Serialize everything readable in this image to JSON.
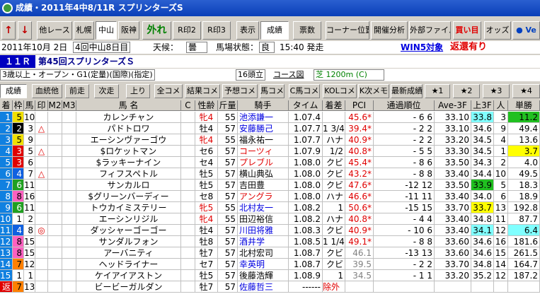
{
  "window": {
    "title": "成績・2011年4中8/11R スプリンターズS"
  },
  "toolbar": {
    "buttons": [
      "↑",
      "↓",
      "他レース",
      "札幌",
      "中山",
      "阪神",
      "外れ",
      "R印2",
      "R印3",
      "表示",
      "成績",
      "票数",
      "コーナー位置",
      "開催分析",
      "外部ファイル",
      "買い目",
      "オッズ",
      "● Ve"
    ],
    "active": [
      "中山",
      "成績"
    ]
  },
  "info": {
    "date": "2011年10月 2日",
    "meeting": "4回中山8日目",
    "weather_label": "天候：",
    "weather": "曇",
    "track_label": "馬場状態：",
    "track": "良",
    "start": "15:40 発走",
    "win5": "WIN5対象",
    "refund": "返還有り",
    "race_no": "１１Ｒ",
    "race_name": "第45回スプリンターズＳ",
    "conditions": "3歳以上・オープン・G1(定量)(国際)(指定)",
    "runners": "16頭立",
    "course_label": "コース図",
    "course": "芝 1200m (C)"
  },
  "tabs": [
    "成績",
    "血統他",
    "前走",
    "次走",
    "上り",
    "全コメ",
    "結果コメ",
    "予想コメ",
    "馬コメ",
    "C馬コメ",
    "KOLコメ",
    "K次メモ",
    "最新成績",
    "★1",
    "★2",
    "★3",
    "★4"
  ],
  "columns": [
    "着",
    "枠",
    "馬",
    "印",
    "M2",
    "M3",
    "馬 名",
    "C",
    "性齢",
    "斤量",
    "騎手",
    "タイム",
    "着差",
    "PCI",
    "通過順位",
    "Ave-3F",
    "上3F",
    "人",
    "単勝"
  ],
  "rows": [
    {
      "pos": "1",
      "waku": "5",
      "uma": "10",
      "mark": "",
      "name": "カレンチャン",
      "sex": "牝4",
      "kin": "55",
      "jockey": "池添謙一",
      "time": "1.07.4",
      "diff": "",
      "pci": "45.6*",
      "pass": "- 6 6",
      "ave": "33.10",
      "up3": "33.8",
      "ninki": "3",
      "odds": "11.2"
    },
    {
      "pos": "2",
      "waku": "2",
      "uma": "3",
      "mark": "△",
      "name": "パドトロワ",
      "sex": "牡4",
      "kin": "57",
      "jockey": "安藤勝己",
      "time": "1.07.7",
      "diff": "1 3/4",
      "pci": "39.4*",
      "pass": "- 2 2",
      "ave": "33.10",
      "up3": "34.6",
      "ninki": "9",
      "odds": "49.4"
    },
    {
      "pos": "3",
      "waku": "5",
      "uma": "9",
      "mark": "",
      "name": "エーシンヴァーゴウ",
      "sex": "牝4",
      "kin": "55",
      "jockey": "福永祐一",
      "time": "1.07.7",
      "diff": "ハナ",
      "pci": "40.9*",
      "pass": "- 2 2",
      "ave": "33.20",
      "up3": "34.5",
      "ninki": "4",
      "odds": "13.6"
    },
    {
      "pos": "4",
      "waku": "3",
      "uma": "5",
      "mark": "△",
      "name": "$ロケットマン",
      "sex": "セ6",
      "kin": "57",
      "jockey": "コーツィ",
      "time": "1.07.9",
      "diff": "1/2",
      "pci": "40.8*",
      "pass": "- 5 5",
      "ave": "33.30",
      "up3": "34.5",
      "ninki": "1",
      "odds": "3.7"
    },
    {
      "pos": "5",
      "waku": "3",
      "uma": "6",
      "mark": "",
      "name": "$ラッキーナイン",
      "sex": "セ4",
      "kin": "57",
      "jockey": "プレブル",
      "time": "1.08.0",
      "diff": "クビ",
      "pci": "45.4*",
      "pass": "- 8 6",
      "ave": "33.50",
      "up3": "34.3",
      "ninki": "2",
      "odds": "4.0"
    },
    {
      "pos": "6",
      "waku": "4",
      "uma": "7",
      "mark": "△",
      "name": "フィフスペトル",
      "sex": "牡5",
      "kin": "57",
      "jockey": "横山典弘",
      "time": "1.08.0",
      "diff": "クビ",
      "pci": "43.2*",
      "pass": "- 8 8",
      "ave": "33.40",
      "up3": "34.4",
      "ninki": "10",
      "odds": "49.5"
    },
    {
      "pos": "7",
      "waku": "6",
      "uma": "11",
      "mark": "",
      "name": "サンカルロ",
      "sex": "牡5",
      "kin": "57",
      "jockey": "吉田豊",
      "time": "1.08.0",
      "diff": "クビ",
      "pci": "47.6*",
      "pass": "-12 12",
      "ave": "33.50",
      "up3": "33.9",
      "ninki": "5",
      "odds": "18.3"
    },
    {
      "pos": "8",
      "waku": "8",
      "uma": "16",
      "mark": "",
      "name": "$グリーンバーディー",
      "sex": "セ8",
      "kin": "57",
      "jockey": "アングラ",
      "time": "1.08.0",
      "diff": "ハナ",
      "pci": "46.6*",
      "pass": "-11 11",
      "ave": "33.40",
      "up3": "34.0",
      "ninki": "6",
      "odds": "18.9"
    },
    {
      "pos": "9",
      "waku": "6",
      "uma": "11",
      "mark": "",
      "name": "トウカイミステリー",
      "sex": "牝5",
      "kin": "55",
      "jockey": "北村友一",
      "time": "1.08.2",
      "diff": "1",
      "pci": "50.6*",
      "pass": "-15 15",
      "ave": "33.70",
      "up3": "33.7",
      "ninki": "13",
      "odds": "192.8"
    },
    {
      "pos": "10",
      "waku": "1",
      "uma": "2",
      "mark": "",
      "name": "エーシンリジル",
      "sex": "牝4",
      "kin": "55",
      "jockey": "田辺裕信",
      "time": "1.08.2",
      "diff": "ハナ",
      "pci": "40.8*",
      "pass": "- 4 4",
      "ave": "33.40",
      "up3": "34.8",
      "ninki": "11",
      "odds": "87.7"
    },
    {
      "pos": "11",
      "waku": "4",
      "uma": "8",
      "mark": "◎",
      "name": "ダッシャーゴーゴー",
      "sex": "牡4",
      "kin": "57",
      "jockey": "川田将雅",
      "time": "1.08.3",
      "diff": "クビ",
      "pci": "40.9*",
      "pass": "- 10 6",
      "ave": "33.40",
      "up3": "34.1",
      "ninki": "12",
      "odds": "6.4"
    },
    {
      "pos": "12",
      "waku": "8",
      "uma": "15",
      "mark": "",
      "name": "サンダルフォン",
      "sex": "牡8",
      "kin": "57",
      "jockey": "酒井学",
      "time": "1.08.5",
      "diff": "1 1/4",
      "pci": "49.1*",
      "pass": "- 8 8",
      "ave": "33.60",
      "up3": "34.6",
      "ninki": "16",
      "odds": "181.6"
    },
    {
      "pos": "13",
      "waku": "8",
      "uma": "15",
      "mark": "",
      "name": "アーバニティ",
      "sex": "牡7",
      "kin": "57",
      "jockey": "北村宏司",
      "time": "1.08.7",
      "diff": "クビ",
      "pci": "46.1",
      "pass": "-13 13",
      "ave": "33.60",
      "up3": "34.6",
      "ninki": "15",
      "odds": "261.5"
    },
    {
      "pos": "14",
      "waku": "7",
      "uma": "12",
      "mark": "",
      "name": "ヘッドライナー",
      "sex": "セ7",
      "kin": "57",
      "jockey": "幸英明",
      "time": "1.08.7",
      "diff": "クビ",
      "pci": "39.5",
      "pass": "- 2 2",
      "ave": "33.70",
      "up3": "34.8",
      "ninki": "14",
      "odds": "164.7"
    },
    {
      "pos": "15",
      "waku": "1",
      "uma": "1",
      "mark": "",
      "name": "ケイアイアストン",
      "sex": "牡5",
      "kin": "57",
      "jockey": "後藤浩輝",
      "time": "1.08.9",
      "diff": "1",
      "pci": "34.5",
      "pass": "- 1 1",
      "ave": "33.20",
      "up3": "35.2",
      "ninki": "12",
      "odds": "187.2"
    },
    {
      "pos": "返",
      "waku": "7",
      "uma": "13",
      "mark": "",
      "name": "ビービーガルダン",
      "sex": "牡7",
      "kin": "57",
      "jockey": "佐藤哲三",
      "time": "------",
      "diff": "除外",
      "pci": "",
      "pass": "",
      "ave": "",
      "up3": "",
      "ninki": "",
      "odds": ""
    }
  ],
  "colors": {
    "title": "#0a3fb8",
    "waku": [
      "#ffffff",
      "#000000",
      "#e00000",
      "#1060e0",
      "#f0e000",
      "#20a020",
      "#ff8000",
      "#ff60c0"
    ],
    "highlight_cyan": "#80ffff",
    "highlight_yellow": "#ffff00",
    "highlight_green": "#20c020",
    "red_text": "#e00000",
    "blue_text": "#0000e0"
  }
}
